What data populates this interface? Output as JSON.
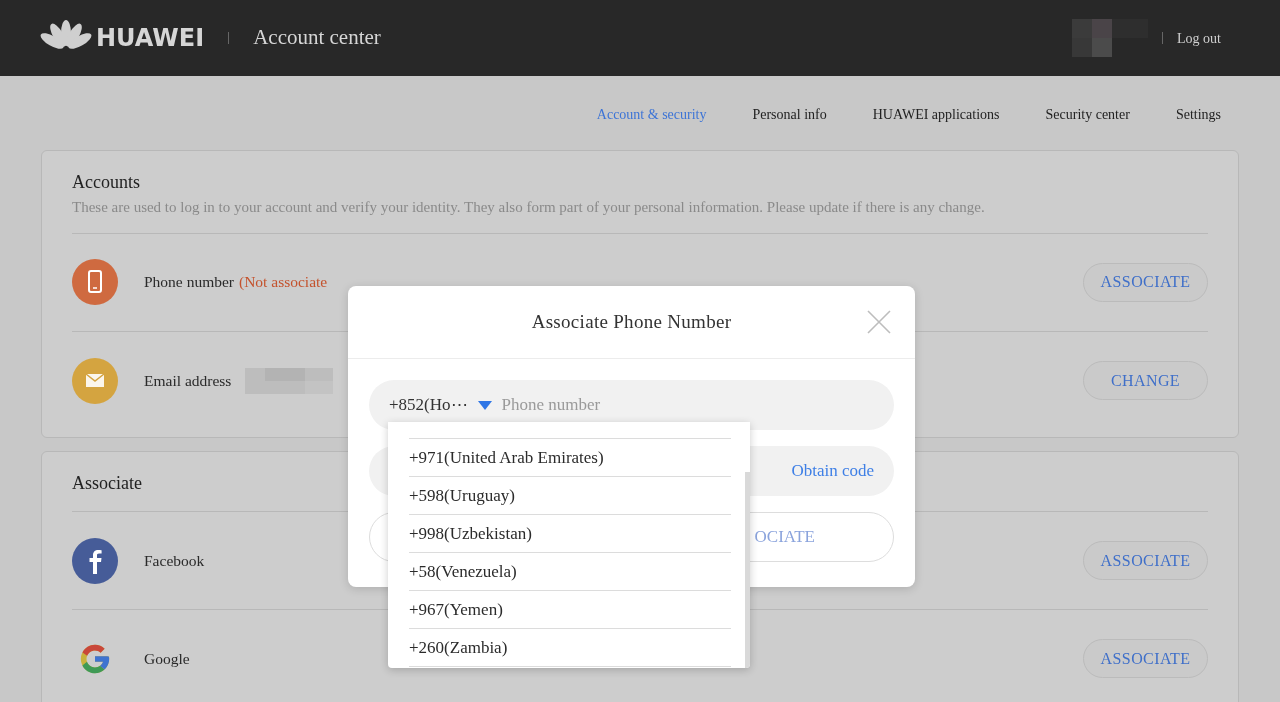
{
  "header": {
    "logo_text": "HUAWEI",
    "title": "Account center",
    "logout": "Log out"
  },
  "nav": [
    {
      "label": "Account & security",
      "selected": true
    },
    {
      "label": "Personal info",
      "selected": false
    },
    {
      "label": "HUAWEI applications",
      "selected": false
    },
    {
      "label": "Security center",
      "selected": false
    },
    {
      "label": "Settings",
      "selected": false
    }
  ],
  "accounts": {
    "title": "Accounts",
    "description": "These are used to log in to your account and verify your identity. They also form part of your personal information. Please update if there is any change.",
    "rows": [
      {
        "kind": "phone",
        "label": "Phone number",
        "status": "(Not associate",
        "action": "ASSOCIATE"
      },
      {
        "kind": "email",
        "label": "Email address",
        "action": "CHANGE"
      }
    ]
  },
  "associate": {
    "title": "Associate",
    "rows": [
      {
        "kind": "facebook",
        "label": "Facebook",
        "action": "ASSOCIATE"
      },
      {
        "kind": "google",
        "label": "Google",
        "action": "ASSOCIATE"
      }
    ]
  },
  "modal": {
    "title": "Associate Phone Number",
    "country_code": "+852(Ho⋯",
    "phone_placeholder": "Phone number",
    "obtain_code": "Obtain code",
    "submit": "OCIATE",
    "dropdown": [
      "+971(United Arab Emirates)",
      "+598(Uruguay)",
      "+998(Uzbekistan)",
      "+58(Venezuela)",
      "+967(Yemen)",
      "+260(Zambia)"
    ]
  }
}
